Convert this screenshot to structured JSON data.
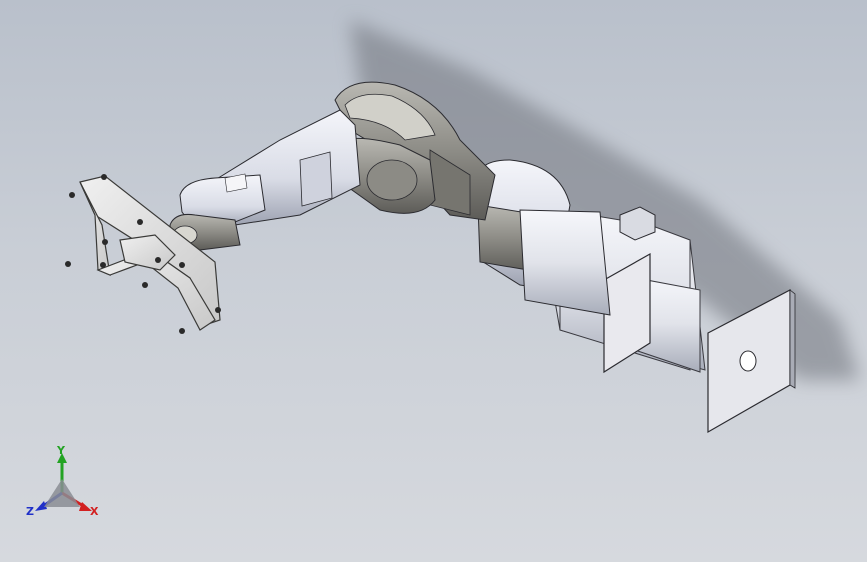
{
  "viewport": {
    "background_top": "#b9c0cb",
    "background_bottom": "#d6d9de"
  },
  "model": {
    "description_icon": "robot-arm-model",
    "body_color": "#e4e6ee",
    "joint_color": "#8a8a86",
    "plate_color": "#dedede",
    "gripper_color": "#d9d6cc"
  },
  "triad": {
    "y_label": "Y",
    "x_label": "X",
    "z_label": "Z",
    "y_color": "#23a323",
    "x_color": "#d22020",
    "z_color": "#2030c8"
  }
}
